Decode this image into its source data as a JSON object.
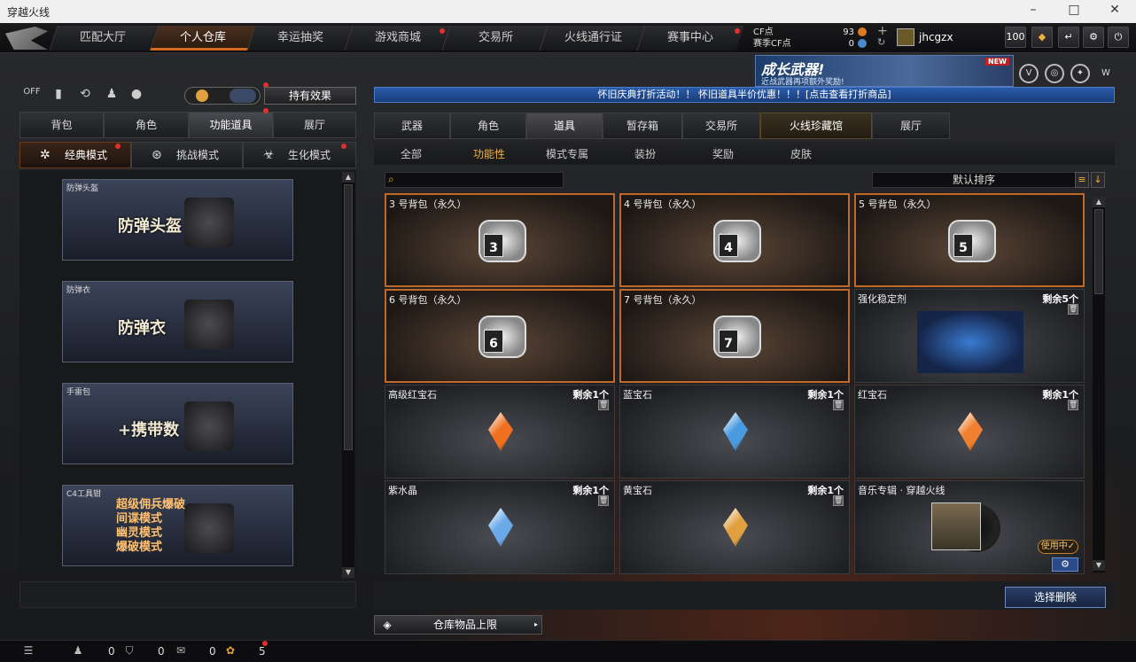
{
  "window": {
    "title": "穿越火线"
  },
  "nav": {
    "tabs": [
      {
        "label": "匹配大厅",
        "dot": false
      },
      {
        "label": "个人仓库",
        "dot": false,
        "active": true
      },
      {
        "label": "幸运抽奖",
        "dot": false
      },
      {
        "label": "游戏商城",
        "dot": true
      },
      {
        "label": "交易所",
        "dot": false
      },
      {
        "label": "火线通行证",
        "dot": false
      },
      {
        "label": "赛事中心",
        "dot": true
      }
    ],
    "cf_label": "CF点",
    "cf_value": "93",
    "season_cf_label": "赛季CF点",
    "season_cf_value": "0",
    "username": "jhcgzx",
    "level_badge": "100"
  },
  "banner": {
    "title": "成长武器!",
    "subtitle": "近战武器再项额外奖励!",
    "new_tag": "NEW"
  },
  "marquee": "怀旧庆典打折活动！！ 怀旧道具半价优惠！！！[点击查看打折商品]",
  "left": {
    "hold_effect_label": "持有效果",
    "tabs": [
      "背包",
      "角色",
      "功能道具",
      "展厅"
    ],
    "active_tab": 2,
    "modes": [
      {
        "label": "经典模式",
        "icon": "crosshair-icon",
        "dot": true
      },
      {
        "label": "挑战模式",
        "icon": "challenge-icon",
        "dot": false
      },
      {
        "label": "生化模式",
        "icon": "biohazard-icon",
        "dot": true
      }
    ],
    "cards": [
      {
        "title": "防弹头盔",
        "big": "防弹头盔"
      },
      {
        "title": "防弹衣",
        "big": "防弹衣"
      },
      {
        "title": "手雷包",
        "big": "+携带数"
      },
      {
        "title": "C4工具钳",
        "big": "",
        "lines": [
          "超级佣兵爆破",
          "间谍模式",
          "幽灵模式",
          "爆破模式"
        ]
      }
    ]
  },
  "right": {
    "tabs": [
      "武器",
      "角色",
      "道具",
      "暂存箱",
      "交易所",
      "火线珍藏馆",
      "展厅"
    ],
    "active_tab": 2,
    "subtabs": [
      "全部",
      "功能性",
      "模式专属",
      "装扮",
      "奖励",
      "皮肤"
    ],
    "active_subtab": 1,
    "search_placeholder": "",
    "sort_label": "默认排序",
    "items": [
      {
        "name": "3 号背包（永久）",
        "kind": "bag",
        "num": "3",
        "remain": ""
      },
      {
        "name": "4 号背包（永久）",
        "kind": "bag",
        "num": "4",
        "remain": ""
      },
      {
        "name": "5 号背包（永久）",
        "kind": "bag",
        "num": "5",
        "remain": ""
      },
      {
        "name": "6 号背包（永久）",
        "kind": "bag",
        "num": "6",
        "remain": ""
      },
      {
        "name": "7 号背包（永久）",
        "kind": "bag",
        "num": "7",
        "remain": ""
      },
      {
        "name": "强化稳定剂",
        "kind": "stabilizer",
        "remain": "剩余5个"
      },
      {
        "name": "高级红宝石",
        "kind": "gem",
        "color": "#f07020",
        "remain": "剩余1个"
      },
      {
        "name": "蓝宝石",
        "kind": "gem",
        "color": "#4a9ae0",
        "remain": "剩余1个"
      },
      {
        "name": "红宝石",
        "kind": "gem",
        "color": "#f08030",
        "remain": "剩余1个"
      },
      {
        "name": "紫水晶",
        "kind": "gem",
        "color": "#6aaae8",
        "remain": "剩余1个"
      },
      {
        "name": "黄宝石",
        "kind": "gem",
        "color": "#e0a040",
        "remain": "剩余1个"
      },
      {
        "name": "音乐专辑 · 穿越火线",
        "kind": "music",
        "remain": "",
        "in_use": "使用中✓"
      }
    ],
    "delete_label": "选择删除",
    "capacity_label": "仓库物品上限"
  },
  "bottom": {
    "counts": [
      "0",
      "0",
      "0",
      "5"
    ]
  },
  "colors": {
    "accent": "#d26a22",
    "marquee": "#2a5caa",
    "bag_border": "#c0682a"
  }
}
